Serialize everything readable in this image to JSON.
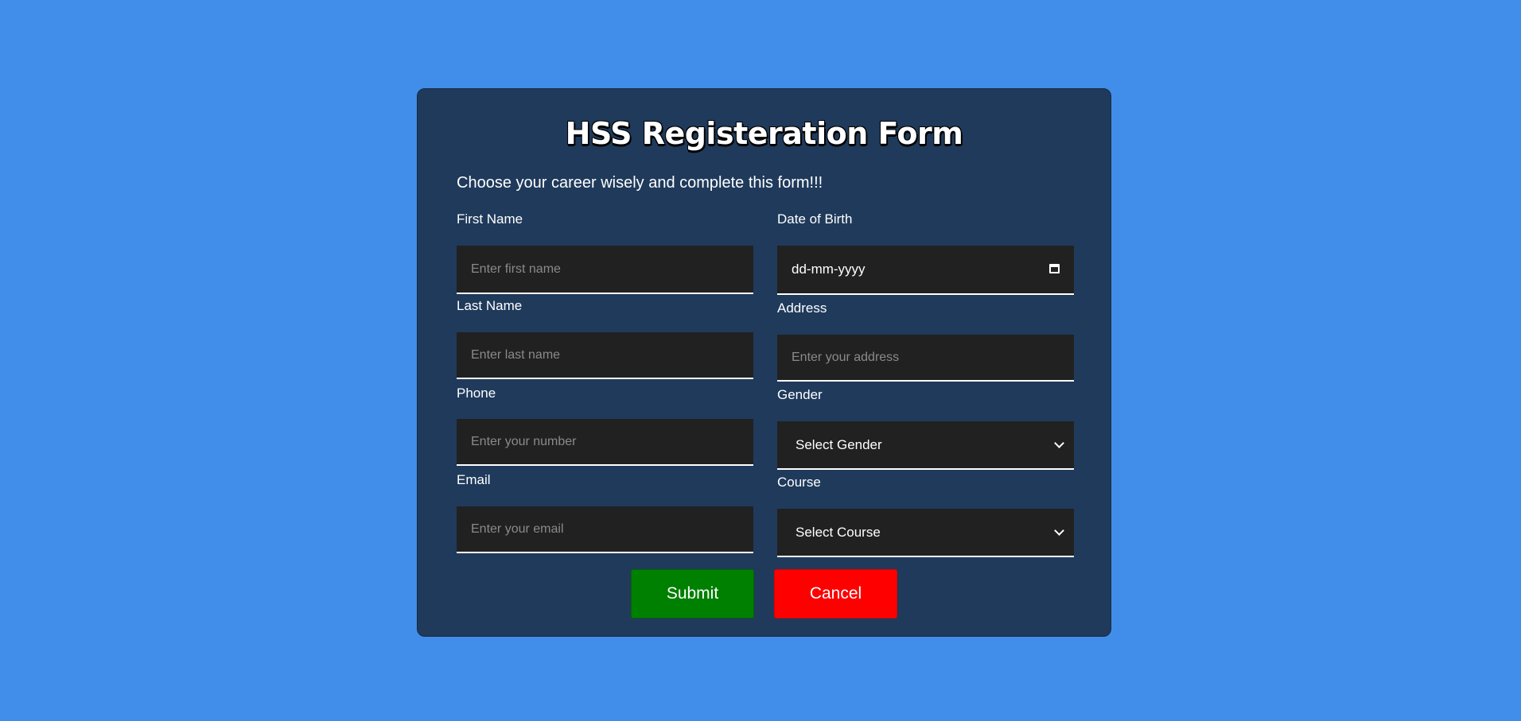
{
  "form": {
    "title": "HSS Registeration Form",
    "subtitle": "Choose your career wisely and complete this form!!!",
    "fields": {
      "first_name": {
        "label": "First Name",
        "placeholder": "Enter first name"
      },
      "last_name": {
        "label": "Last Name",
        "placeholder": "Enter last name"
      },
      "phone": {
        "label": "Phone",
        "placeholder": "Enter your number"
      },
      "email": {
        "label": "Email",
        "placeholder": "Enter your email"
      },
      "dob": {
        "label": "Date of Birth",
        "value": "dd-mm-yyyy"
      },
      "address": {
        "label": "Address",
        "placeholder": "Enter your address"
      },
      "gender": {
        "label": "Gender",
        "selected": "Select Gender"
      },
      "course": {
        "label": "Course",
        "selected": "Select Course"
      }
    },
    "buttons": {
      "submit": "Submit",
      "cancel": "Cancel"
    }
  },
  "colors": {
    "page_background": "#418dea",
    "card_background": "#1f3a5b",
    "input_background": "#212121",
    "submit": "#008000",
    "cancel": "#ff0000"
  },
  "icons": {
    "date": "calendar-icon",
    "select": "chevron-down-icon"
  }
}
